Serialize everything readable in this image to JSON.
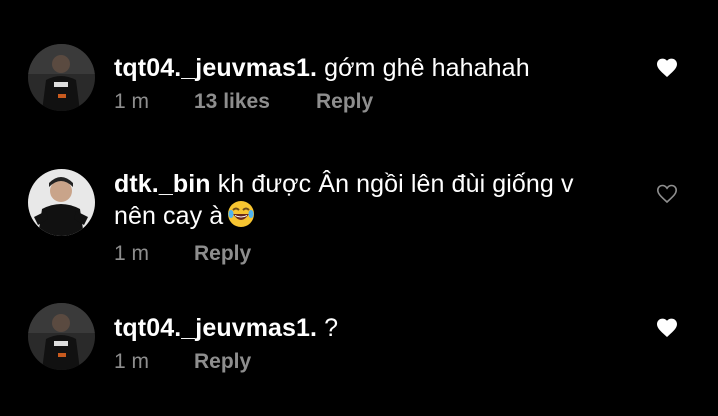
{
  "comments": [
    {
      "username": "tqt04._jeuvmas1.",
      "text_line1": "gớm ghê hahahah",
      "text_line2": "",
      "time": "1 m",
      "likes": "13 likes",
      "reply": "Reply",
      "liked": true,
      "avatar_icon": "profile-photo-dark-shirt"
    },
    {
      "username": "dtk._bin",
      "text_line1": "kh được Ân ngồi lên đùi giống v",
      "text_line2": "nên cay à",
      "emoji": "😂",
      "time": "1 m",
      "likes": "",
      "reply": "Reply",
      "liked": false,
      "avatar_icon": "profile-photo-black-hoodie"
    },
    {
      "username": "tqt04._jeuvmas1.",
      "text_line1": "?",
      "text_line2": "",
      "time": "1 m",
      "likes": "",
      "reply": "Reply",
      "liked": true,
      "avatar_icon": "profile-photo-dark-shirt"
    }
  ],
  "colors": {
    "background": "#000000",
    "text": "#ffffff",
    "meta": "#8e8e8e",
    "heart_filled": "#ffffff",
    "heart_outline": "#8e8e8e"
  }
}
